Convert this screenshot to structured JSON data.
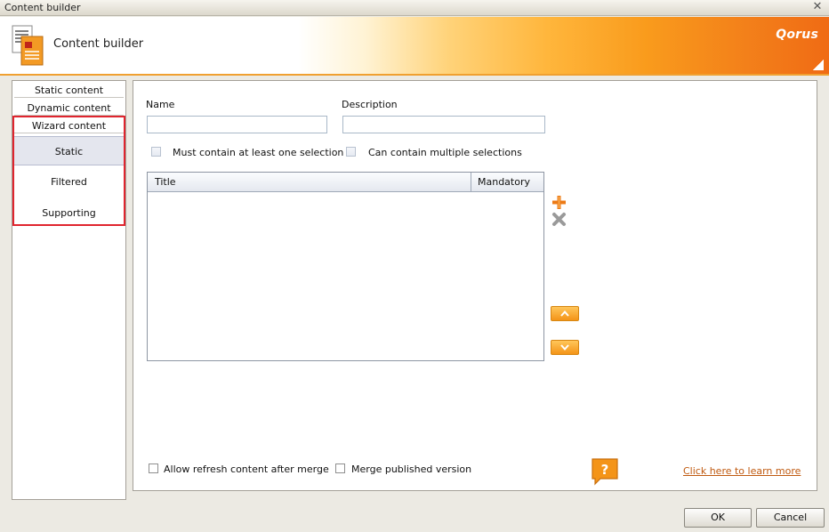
{
  "window": {
    "title": "Content builder"
  },
  "banner": {
    "title": "Content builder",
    "brand": "Qorus"
  },
  "nav": {
    "items": [
      {
        "label": "Static content"
      },
      {
        "label": "Dynamic content"
      },
      {
        "label": "Wizard content"
      }
    ],
    "sub_items": [
      {
        "label": "Static",
        "selected": true
      },
      {
        "label": "Filtered"
      },
      {
        "label": "Supporting"
      }
    ]
  },
  "form": {
    "name_label": "Name",
    "name_value": "",
    "description_label": "Description",
    "description_value": "",
    "must_contain_label": "Must contain at least one selection",
    "multiple_label": "Can contain multiple selections"
  },
  "grid": {
    "columns": [
      "Title",
      "Mandatory"
    ],
    "rows": []
  },
  "options": {
    "refresh_label": "Allow refresh content after merge",
    "merge_label": "Merge published version"
  },
  "help": {
    "link_text": "Click here to learn more"
  },
  "footer": {
    "ok_label": "OK",
    "cancel_label": "Cancel"
  },
  "colors": {
    "accent": "#f49418",
    "highlight_border": "#e0252f",
    "link": "#c05a10"
  },
  "icons": [
    "close-icon",
    "document-icon",
    "add-icon",
    "remove-icon",
    "move-up-icon",
    "move-down-icon",
    "help-icon"
  ]
}
